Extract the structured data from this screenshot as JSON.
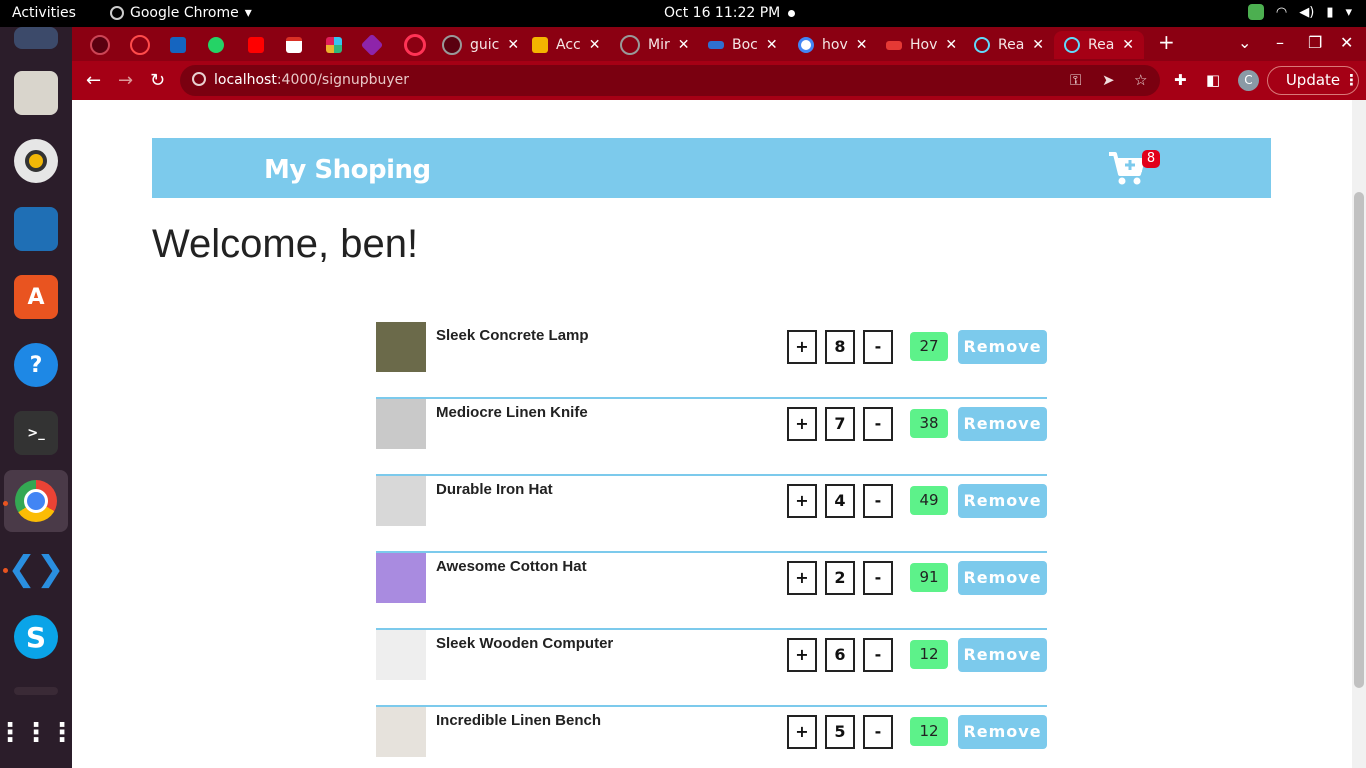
{
  "topbar": {
    "activities": "Activities",
    "app_name": "Google Chrome",
    "clock": "Oct 16  11:22 PM"
  },
  "chrome": {
    "tabs": [
      {
        "label": "guic",
        "color": "#444444"
      },
      {
        "label": "Acc",
        "color": "#f4b400"
      },
      {
        "label": "Mir",
        "color": "#222222"
      },
      {
        "label": "Boc",
        "color": "#2f6fd1"
      },
      {
        "label": "hov",
        "color": "#ffffff"
      },
      {
        "label": "Hov",
        "color": "#e53935"
      },
      {
        "label": "Rea",
        "color": "#61dafb"
      },
      {
        "label": "Rea",
        "color": "#61dafb"
      }
    ],
    "url_host": "localhost",
    "url_path": ":4000/signupbuyer",
    "profile_initial": "C",
    "update_label": "Update"
  },
  "app": {
    "brand": "My Shoping",
    "cart_count": "8",
    "welcome": "Welcome, ben!",
    "plus_label": "+",
    "minus_label": "-",
    "remove_label": "Remove"
  },
  "cart_items": [
    {
      "name": "Sleek Concrete Lamp",
      "qty": "8",
      "price": "27",
      "thumb_color": "#6b6a4a"
    },
    {
      "name": "Mediocre Linen Knife",
      "qty": "7",
      "price": "38",
      "thumb_color": "#c9c9c9"
    },
    {
      "name": "Durable Iron Hat",
      "qty": "4",
      "price": "49",
      "thumb_color": "#d8d8d8"
    },
    {
      "name": "Awesome Cotton Hat",
      "qty": "2",
      "price": "91",
      "thumb_color": "#a98be0"
    },
    {
      "name": "Sleek Wooden Computer",
      "qty": "6",
      "price": "12",
      "thumb_color": "#eeeeee"
    },
    {
      "name": "Incredible Linen Bench",
      "qty": "5",
      "price": "12",
      "thumb_color": "#e6e2dc"
    }
  ],
  "colors": {
    "accent": "#7ccaec",
    "price_bg": "#5df28a",
    "badge": "#e1001a",
    "chrome_frame": "#8b0012"
  }
}
